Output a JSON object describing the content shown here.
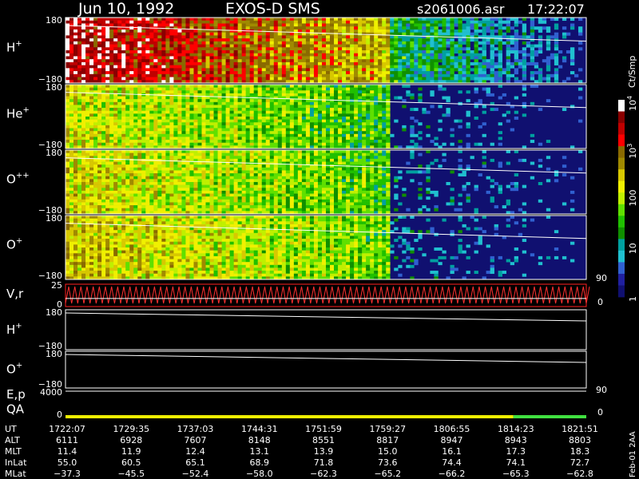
{
  "header": {
    "date": "Jun 10, 1992",
    "instrument": "EXOS-D SMS",
    "file": "s2061006.asr",
    "time": "17:22:07"
  },
  "chart_data": {
    "type": "heatmap",
    "panels": [
      {
        "label": "H",
        "sup": "+",
        "ytop": "180",
        "ybottom": "−180",
        "kind": "spectro",
        "intensity": 0.92
      },
      {
        "label": "He",
        "sup": "+",
        "ytop": "180",
        "ybottom": "−180",
        "kind": "spectro",
        "intensity": 0.55
      },
      {
        "label": "O",
        "sup": "++",
        "ytop": "180",
        "ybottom": "−180",
        "kind": "spectro",
        "intensity": 0.58
      },
      {
        "label": "O",
        "sup": "+",
        "ytop": "180",
        "ybottom": "−180",
        "kind": "spectro",
        "intensity": 0.62
      },
      {
        "label": "V,r",
        "sup": "",
        "ytop": "25",
        "ybottom": "0",
        "kind": "vr",
        "rightTop": "90",
        "rightBottom": "0"
      },
      {
        "label": "H",
        "sup": "+",
        "ytop": "180",
        "ybottom": "−180",
        "kind": "line"
      },
      {
        "label": "O",
        "sup": "+",
        "ytop": "180",
        "ybottom": "−180",
        "kind": "line"
      },
      {
        "label": "E,p",
        "sup": "",
        "ytop": "4000",
        "ybottom": "",
        "kind": "ep",
        "rightMid": "90"
      },
      {
        "label": "QA",
        "sup": "",
        "ytop": "",
        "ybottom": "0",
        "kind": "qa",
        "rightBottom": "0"
      }
    ],
    "colorbar": {
      "unit": "Ct/Smp",
      "ticks": [
        {
          "label": "10",
          "sup": "4",
          "value": 10000
        },
        {
          "label": "10",
          "sup": "3",
          "value": 1000
        },
        {
          "label": "100",
          "sup": "",
          "value": 100
        },
        {
          "label": "10",
          "sup": "",
          "value": 10
        },
        {
          "label": "1",
          "sup": "",
          "value": 1
        }
      ],
      "colors": [
        "#ffffff",
        "#8a0000",
        "#c00000",
        "#ff0000",
        "#8a6a00",
        "#a08a00",
        "#d8c800",
        "#f0f000",
        "#c0f000",
        "#60e000",
        "#20c000",
        "#109000",
        "#00a0a0",
        "#20c0d0",
        "#3060d0",
        "#2020a0",
        "#101070"
      ]
    },
    "time_axis": {
      "rows": [
        {
          "name": "UT",
          "values": [
            "1722:07",
            "1729:35",
            "1737:03",
            "1744:31",
            "1751:59",
            "1759:27",
            "1806:55",
            "1814:23",
            "1821:51"
          ]
        },
        {
          "name": "ALT",
          "values": [
            "6111",
            "6928",
            "7607",
            "8148",
            "8551",
            "8817",
            "8947",
            "8943",
            "8803"
          ]
        },
        {
          "name": "MLT",
          "values": [
            "11.4",
            "11.9",
            "12.4",
            "13.1",
            "13.9",
            "15.0",
            "16.1",
            "17.3",
            "18.3"
          ]
        },
        {
          "name": "InLat",
          "values": [
            "55.0",
            "60.5",
            "65.1",
            "68.9",
            "71.8",
            "73.6",
            "74.4",
            "74.1",
            "72.7"
          ]
        },
        {
          "name": "MLat",
          "values": [
            "−37.3",
            "−45.5",
            "−52.4",
            "−58.0",
            "−62.3",
            "−65.2",
            "−66.2",
            "−65.3",
            "−62.8"
          ]
        }
      ]
    },
    "footer_note": "Feb-01 2AA"
  }
}
